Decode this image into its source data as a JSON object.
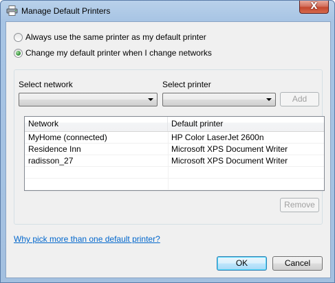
{
  "window": {
    "title": "Manage Default Printers",
    "close_label": "X"
  },
  "mode": {
    "option_same": "Always use the same printer as my default printer",
    "option_network": "Change my default printer when I change networks",
    "selected": "network"
  },
  "network_group": {
    "select_network_label": "Select network",
    "select_network_value": "",
    "select_printer_label": "Select printer",
    "select_printer_value": "",
    "add_label": "Add",
    "add_enabled": false,
    "columns": [
      "Network",
      "Default printer"
    ],
    "rows": [
      {
        "network": "MyHome (connected)",
        "printer": "HP Color LaserJet 2600n"
      },
      {
        "network": "Residence Inn",
        "printer": "Microsoft XPS Document Writer"
      },
      {
        "network": "radisson_27",
        "printer": "Microsoft XPS Document Writer"
      },
      {
        "network": "",
        "printer": ""
      },
      {
        "network": "",
        "printer": ""
      }
    ],
    "remove_label": "Remove",
    "remove_enabled": false
  },
  "help_link": "Why pick more than one default printer?",
  "footer": {
    "ok_label": "OK",
    "cancel_label": "Cancel"
  },
  "colors": {
    "title_gradient_top": "#b9d1ea",
    "close_button": "#c4482f",
    "link": "#0066cc",
    "dialog_bg": "#f0f0f0"
  }
}
